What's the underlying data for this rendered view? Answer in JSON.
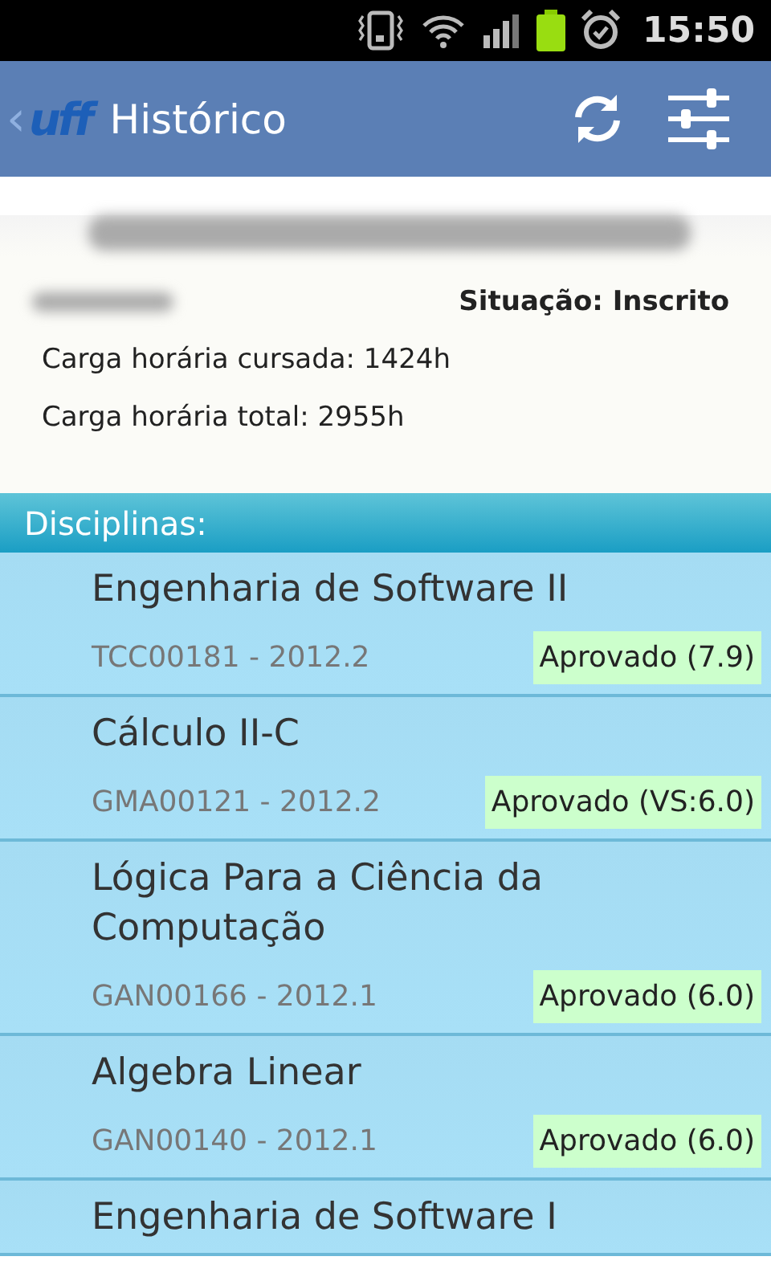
{
  "status_bar": {
    "time": "15:50"
  },
  "app_bar": {
    "back": "‹",
    "logo": "uff",
    "title": "Histórico"
  },
  "student": {
    "situation": "Situação: Inscrito",
    "hours_taken": "Carga horária cursada: 1424h",
    "hours_total": "Carga horária total: 2955h"
  },
  "section": {
    "title": "Disciplinas:"
  },
  "courses": [
    {
      "name": "Engenharia de Software II",
      "code": "TCC00181 - 2012.2",
      "result": "Aprovado (7.9)"
    },
    {
      "name": "Cálculo II-C",
      "code": "GMA00121 - 2012.2",
      "result": "Aprovado (VS:6.0)"
    },
    {
      "name": "Lógica Para a Ciência da Computação",
      "code": "GAN00166 - 2012.1",
      "result": "Aprovado (6.0)"
    },
    {
      "name": "Algebra Linear",
      "code": "GAN00140 - 2012.1",
      "result": "Aprovado (6.0)"
    },
    {
      "name": "Engenharia de Software I"
    }
  ]
}
